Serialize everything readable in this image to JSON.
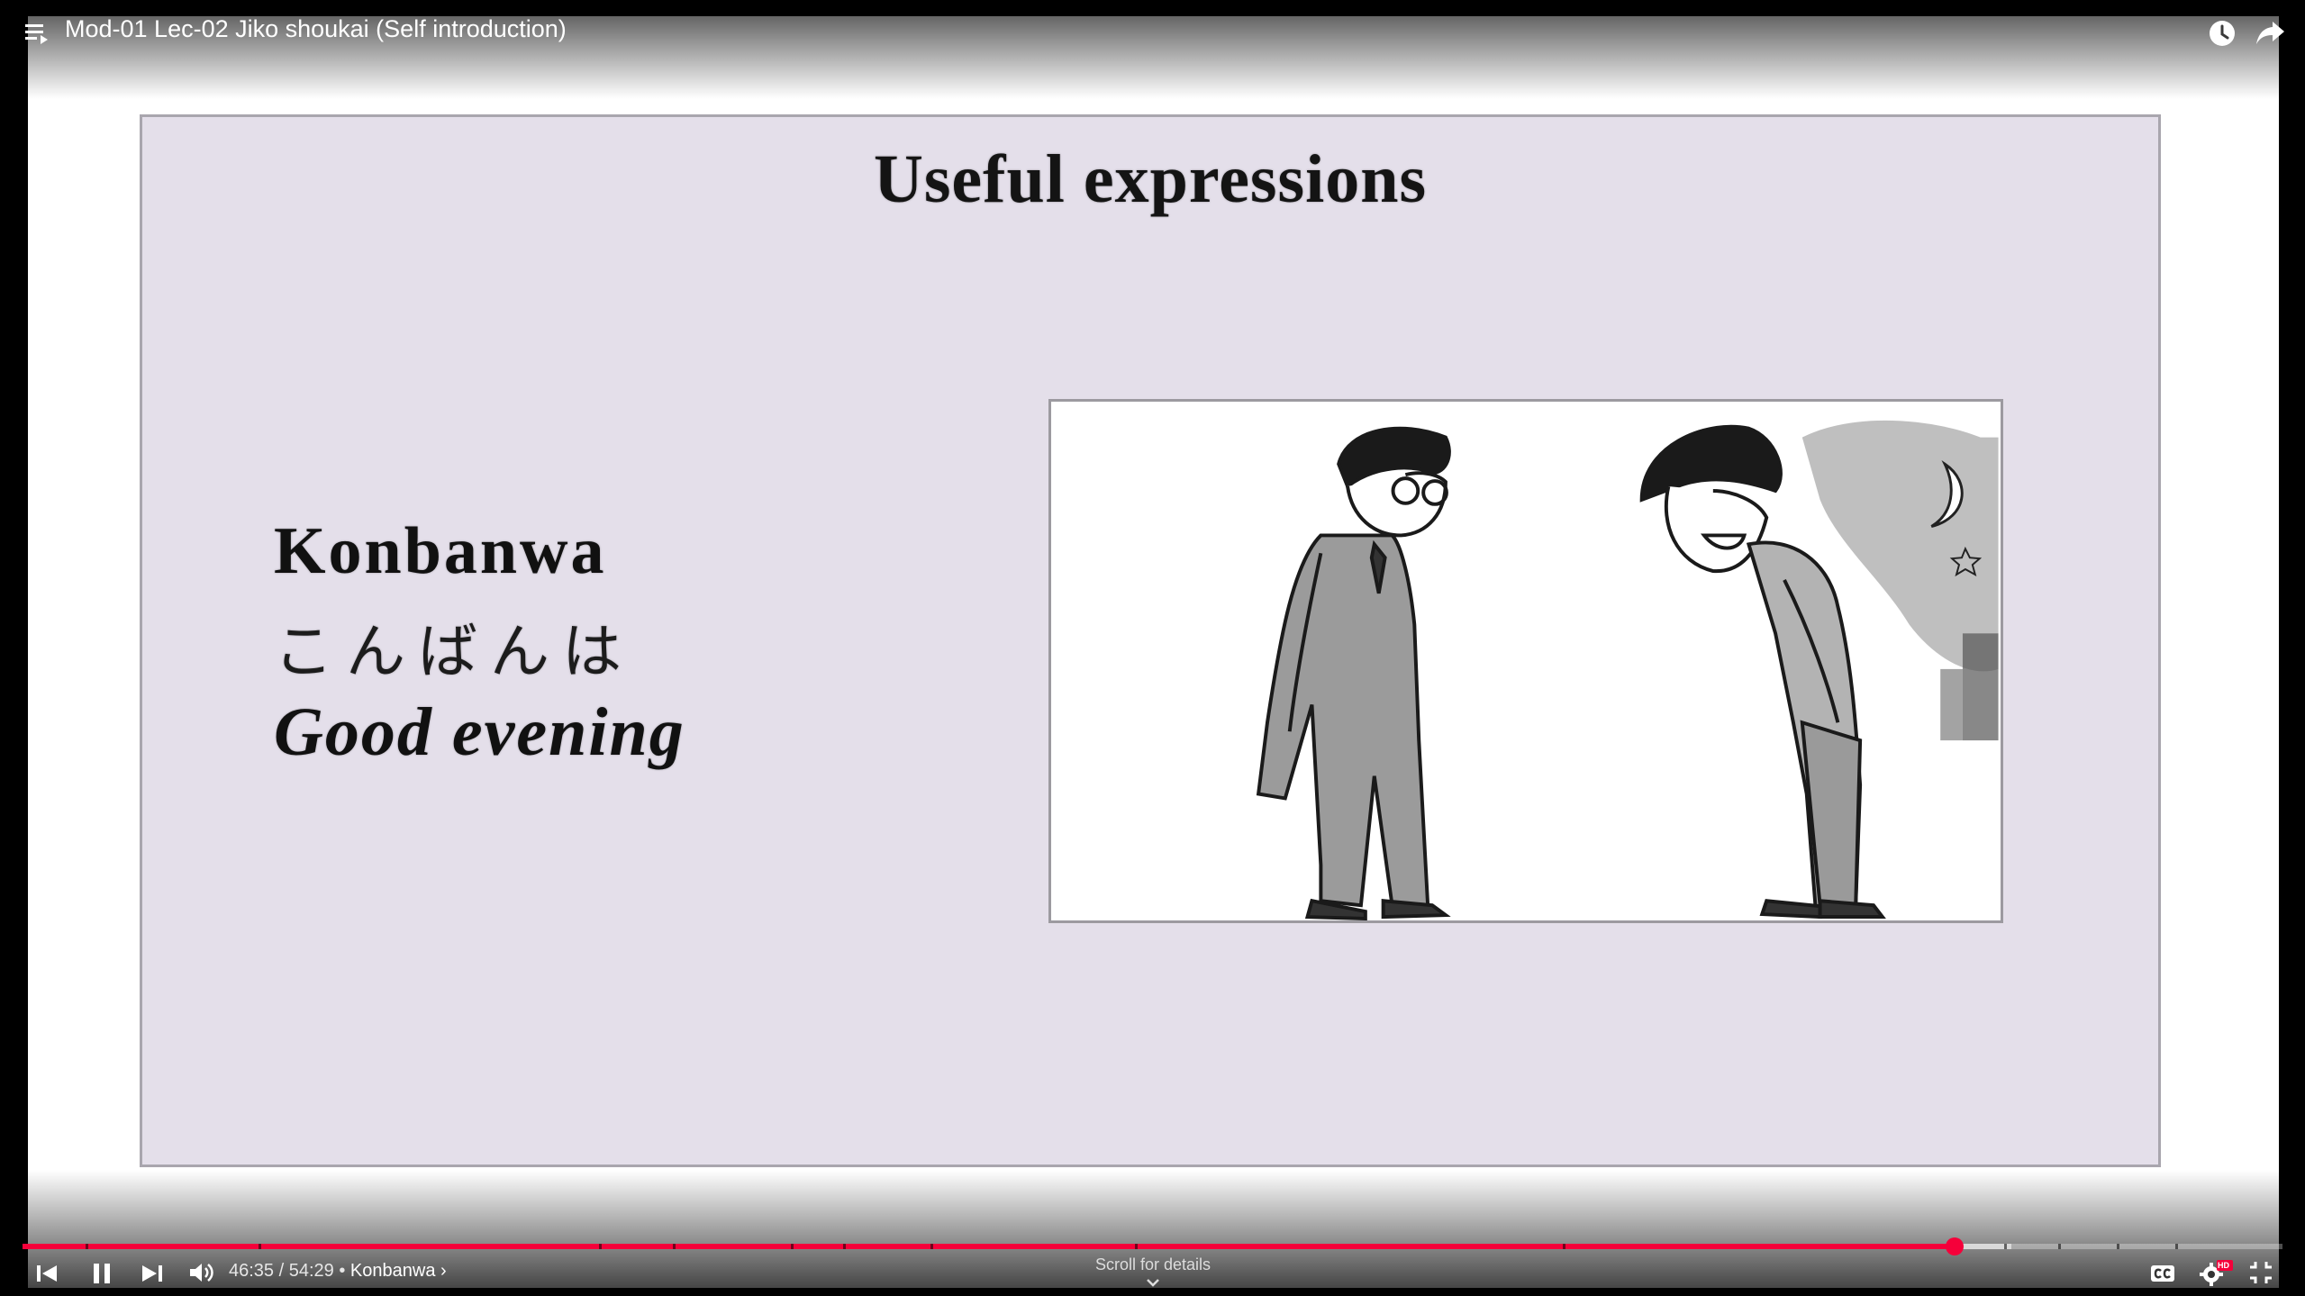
{
  "header": {
    "title": "Mod-01 Lec-02 Jiko shoukai (Self introduction)",
    "icons": [
      "playlist-icon",
      "clock-icon",
      "share-icon"
    ]
  },
  "slide": {
    "title": "Useful expressions",
    "romaji": "Konbanwa",
    "kana": "こんばんは",
    "english": "Good evening",
    "background_color": "#e4dfea"
  },
  "player": {
    "current_time": "46:35",
    "duration": "54:29",
    "time_separator": " / ",
    "chapter_separator": " • ",
    "chapter": "Konbanwa ›",
    "scroll_hint": "Scroll for details",
    "progress_played_fraction": 0.855,
    "progress_loaded_fraction": 0.88,
    "accent_color": "#f5003a",
    "icons": [
      "previous-icon",
      "pause-icon",
      "next-icon",
      "volume-icon",
      "captions-icon",
      "settings-hd-icon",
      "exit-fullscreen-icon"
    ],
    "settings_badge": "HD"
  }
}
